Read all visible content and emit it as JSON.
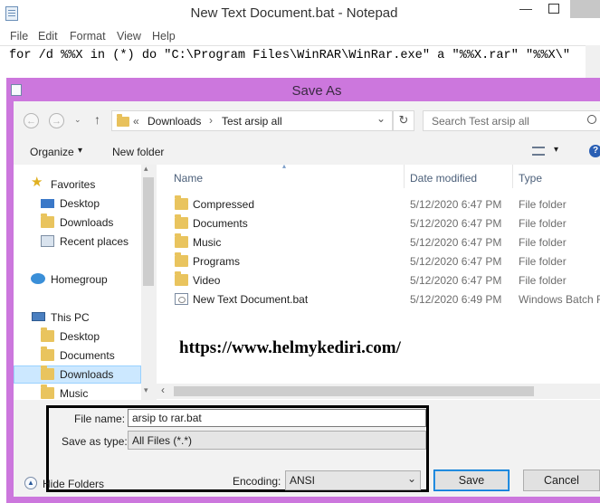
{
  "notepad": {
    "title": "New Text Document.bat - Notepad",
    "minimize_glyph": "—",
    "menu": [
      "File",
      "Edit",
      "Format",
      "View",
      "Help"
    ],
    "content": "for /d %%X in (*) do \"C:\\Program Files\\WinRAR\\WinRar.exe\" a \"%%X.rar\" \"%%X\\\""
  },
  "dialog": {
    "title": "Save As",
    "nav": {
      "back": "←",
      "forward": "→",
      "up": "↑",
      "dropdown": "⌄"
    },
    "address": {
      "prefix": "«",
      "path": [
        "Downloads",
        "Test arsip all"
      ],
      "separator": "›",
      "dropdown": "⌄"
    },
    "refresh_glyph": "↻",
    "search_placeholder": "Search Test arsip all",
    "toolbar": {
      "organize": "Organize",
      "organize_arrow": "▾",
      "new_folder": "New folder",
      "views_arrow": "▾",
      "help": "?"
    },
    "nav_pane": {
      "favorites": "Favorites",
      "favorites_items": [
        "Desktop",
        "Downloads",
        "Recent places"
      ],
      "homegroup": "Homegroup",
      "this_pc": "This PC",
      "this_pc_items": [
        "Desktop",
        "Documents",
        "Downloads",
        "Music"
      ],
      "selected": "Downloads"
    },
    "columns": {
      "name": "Name",
      "date": "Date modified",
      "type": "Type"
    },
    "files": [
      {
        "name": "Compressed",
        "date": "5/12/2020 6:47 PM",
        "type": "File folder",
        "icon": "folder"
      },
      {
        "name": "Documents",
        "date": "5/12/2020 6:47 PM",
        "type": "File folder",
        "icon": "folder"
      },
      {
        "name": "Music",
        "date": "5/12/2020 6:47 PM",
        "type": "File folder",
        "icon": "folder"
      },
      {
        "name": "Programs",
        "date": "5/12/2020 6:47 PM",
        "type": "File folder",
        "icon": "folder"
      },
      {
        "name": "Video",
        "date": "5/12/2020 6:47 PM",
        "type": "File folder",
        "icon": "folder"
      },
      {
        "name": "New Text Document.bat",
        "date": "5/12/2020 6:49 PM",
        "type": "Windows Batch F",
        "icon": "batch-file"
      }
    ],
    "scroll_glyphs": {
      "up": "▴",
      "down": "▾",
      "left": "‹"
    },
    "filename_label": "File name:",
    "filename_value": "arsip to rar.bat",
    "savetype_label": "Save as type:",
    "savetype_value": "All Files  (*.*)",
    "hide_folders_glyph": "▲",
    "hide_folders": "Hide Folders",
    "encoding_label": "Encoding:",
    "encoding_value": "ANSI",
    "select_arrow": "⌄",
    "save": "Save",
    "cancel": "Cancel"
  },
  "watermark": "https://www.helmykediri.com/",
  "colors": {
    "dialog_frame": "#cc77dd",
    "highlight_border": "#000000",
    "selection": "#cce8ff",
    "folder": "#e9c45e"
  }
}
